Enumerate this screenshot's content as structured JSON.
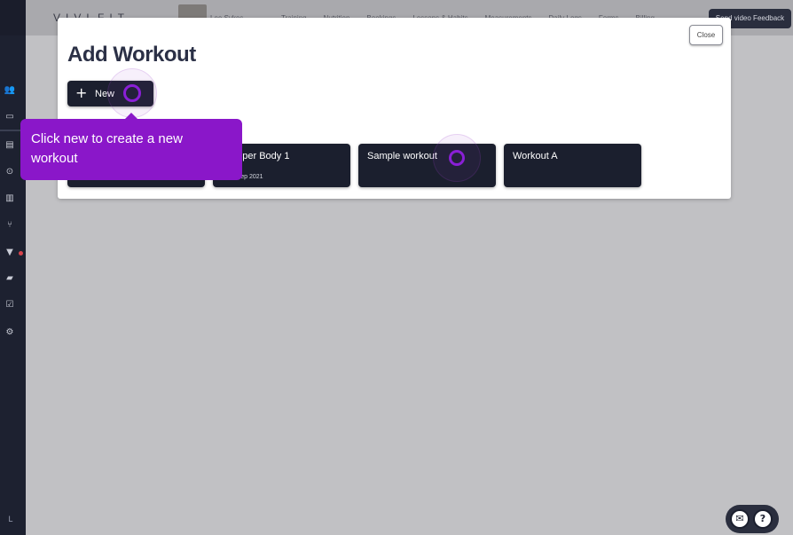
{
  "app": {
    "brand": "VIVLFIT"
  },
  "header": {
    "username": "Lee Sykes",
    "nav": [
      "Training",
      "Nutrition",
      "Bookings",
      "Lessons & Habits",
      "Measurements",
      "Daily Logs",
      "Forms",
      "Billing"
    ],
    "feedback_label": "Send video Feedback"
  },
  "sidebar": {
    "icons": [
      "users-icon",
      "calendar-icon",
      "notes-icon",
      "target-icon",
      "chart-icon",
      "fork-knife-icon",
      "cocktail-icon",
      "book-icon",
      "checklist-icon",
      "settings-icon"
    ],
    "user_initial": "L",
    "notification_color": "#d8444c"
  },
  "modal": {
    "title": "Add Workout",
    "close_label": "Close",
    "new_button": {
      "icon": "plus-icon",
      "label": "New"
    },
    "cards": [
      {
        "name": "",
        "date": ""
      },
      {
        "name": "e Upper Body 1",
        "date": "y, 24 Sep 2021"
      },
      {
        "name": "Sample workout",
        "date": ""
      },
      {
        "name": "Workout A",
        "date": ""
      }
    ]
  },
  "tooltip": {
    "text": "Click new to create a new workout",
    "color": "#8a17c9"
  },
  "widget": {
    "icons": [
      "mail-icon",
      "help-icon"
    ]
  },
  "colors": {
    "accent": "#8a1fd6",
    "button_dark": "#1b1f2e",
    "sidebar": "#1d2130"
  }
}
